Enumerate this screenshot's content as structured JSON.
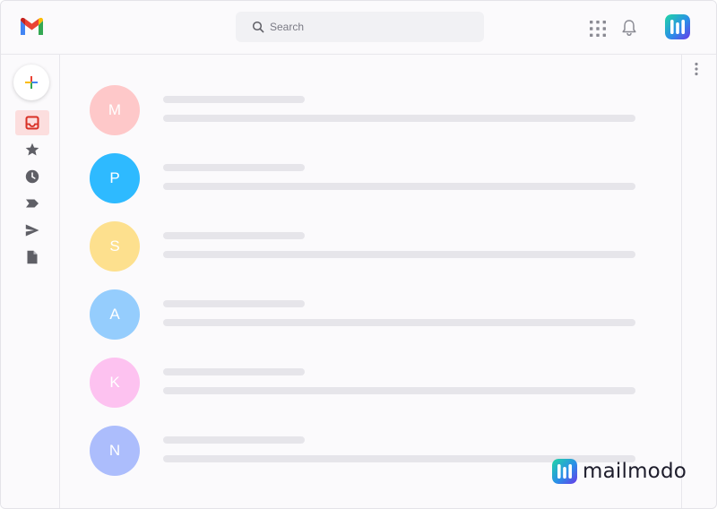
{
  "search": {
    "placeholder": "Search"
  },
  "icons": {
    "logo": "gmail-logo-icon",
    "search": "search-icon",
    "apps": "apps-grid-icon",
    "notifications": "bell-icon",
    "account": "mailmodo-logo-icon",
    "compose": "plus-icon",
    "more": "kebab-icon"
  },
  "sidebar": {
    "items": [
      {
        "name": "inbox",
        "icon": "inbox-icon",
        "active": true
      },
      {
        "name": "starred",
        "icon": "star-icon",
        "active": false
      },
      {
        "name": "snoozed",
        "icon": "clock-icon",
        "active": false
      },
      {
        "name": "important",
        "icon": "label-icon",
        "active": false
      },
      {
        "name": "sent",
        "icon": "send-icon",
        "active": false
      },
      {
        "name": "drafts",
        "icon": "document-icon",
        "active": false
      }
    ]
  },
  "messages": [
    {
      "initial": "M",
      "color": "#fec8c9"
    },
    {
      "initial": "P",
      "color": "#2ebaff"
    },
    {
      "initial": "S",
      "color": "#fde08e"
    },
    {
      "initial": "A",
      "color": "#95cdfd"
    },
    {
      "initial": "K",
      "color": "#fdc2f0"
    },
    {
      "initial": "N",
      "color": "#acbdfc"
    }
  ],
  "watermark": {
    "text": "mailmodo"
  },
  "colors": {
    "accent": "#d93025",
    "active_bg": "#fcdede",
    "skeleton": "#e6e5ea",
    "icon_gray": "#5f5f66"
  }
}
